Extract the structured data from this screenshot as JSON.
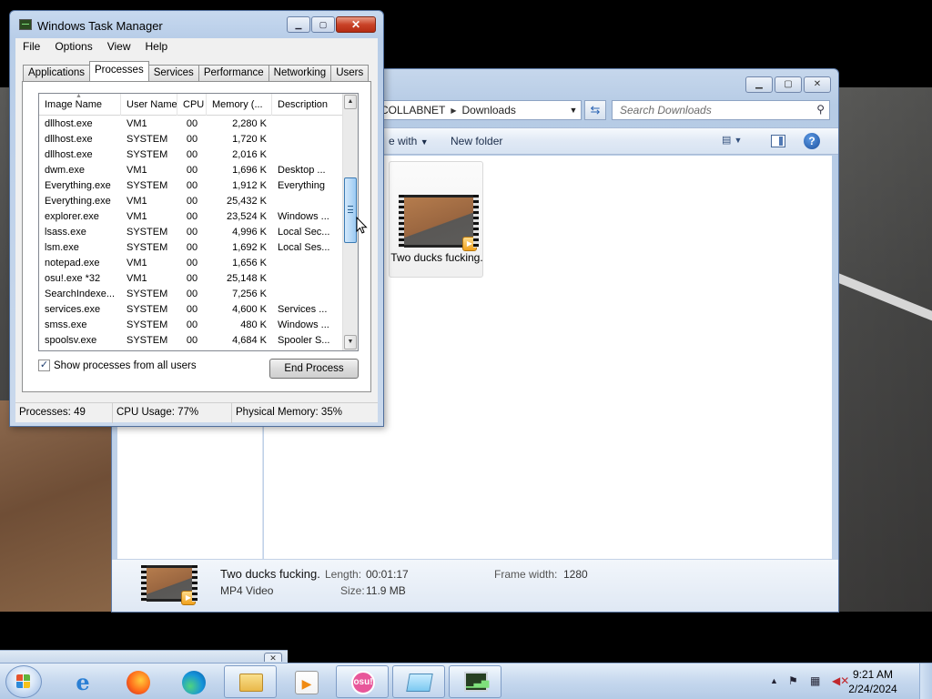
{
  "task_manager": {
    "title": "Windows Task Manager",
    "menu": [
      "File",
      "Options",
      "View",
      "Help"
    ],
    "tabs": [
      "Applications",
      "Processes",
      "Services",
      "Performance",
      "Networking",
      "Users"
    ],
    "active_tab": "Processes",
    "columns": [
      "Image Name",
      "User Name",
      "CPU",
      "Memory (...",
      "Description"
    ],
    "processes": [
      {
        "name": "dllhost.exe",
        "user": "VM1",
        "cpu": "00",
        "mem": "2,280 K",
        "desc": ""
      },
      {
        "name": "dllhost.exe",
        "user": "SYSTEM",
        "cpu": "00",
        "mem": "1,720 K",
        "desc": ""
      },
      {
        "name": "dllhost.exe",
        "user": "SYSTEM",
        "cpu": "00",
        "mem": "2,016 K",
        "desc": ""
      },
      {
        "name": "dwm.exe",
        "user": "VM1",
        "cpu": "00",
        "mem": "1,696 K",
        "desc": "Desktop ..."
      },
      {
        "name": "Everything.exe",
        "user": "SYSTEM",
        "cpu": "00",
        "mem": "1,912 K",
        "desc": "Everything"
      },
      {
        "name": "Everything.exe",
        "user": "VM1",
        "cpu": "00",
        "mem": "25,432 K",
        "desc": ""
      },
      {
        "name": "explorer.exe",
        "user": "VM1",
        "cpu": "00",
        "mem": "23,524 K",
        "desc": "Windows ..."
      },
      {
        "name": "lsass.exe",
        "user": "SYSTEM",
        "cpu": "00",
        "mem": "4,996 K",
        "desc": "Local Sec..."
      },
      {
        "name": "lsm.exe",
        "user": "SYSTEM",
        "cpu": "00",
        "mem": "1,692 K",
        "desc": "Local Ses..."
      },
      {
        "name": "notepad.exe",
        "user": "VM1",
        "cpu": "00",
        "mem": "1,656 K",
        "desc": ""
      },
      {
        "name": "osu!.exe *32",
        "user": "VM1",
        "cpu": "00",
        "mem": "25,148 K",
        "desc": ""
      },
      {
        "name": "SearchIndexe...",
        "user": "SYSTEM",
        "cpu": "00",
        "mem": "7,256 K",
        "desc": ""
      },
      {
        "name": "services.exe",
        "user": "SYSTEM",
        "cpu": "00",
        "mem": "4,600 K",
        "desc": "Services ..."
      },
      {
        "name": "smss.exe",
        "user": "SYSTEM",
        "cpu": "00",
        "mem": "480 K",
        "desc": "Windows ..."
      },
      {
        "name": "spoolsv.exe",
        "user": "SYSTEM",
        "cpu": "00",
        "mem": "4,684 K",
        "desc": "Spooler S..."
      }
    ],
    "show_all_label": "Show processes from all users",
    "show_all_checked": "✓",
    "end_process_label": "End Process",
    "status": {
      "processes": "Processes: 49",
      "cpu": "CPU Usage: 77%",
      "memory": "Physical Memory: 35%"
    }
  },
  "explorer": {
    "breadcrumb": [
      "COLLABNET",
      "Downloads"
    ],
    "search_placeholder": "Search Downloads",
    "cmd_partial": "e with",
    "cmd_new_folder": "New folder",
    "file": {
      "name": "Two ducks fucking.",
      "type": "MP4 Video",
      "length_label": "Length:",
      "length": "00:01:17",
      "size_label": "Size:",
      "size": "11.9 MB",
      "frame_width_label": "Frame width:",
      "frame_width": "1280"
    }
  },
  "taskbar": {
    "clock_time": "9:21 AM",
    "clock_date": "2/24/2024",
    "osu_label": "osu!"
  }
}
